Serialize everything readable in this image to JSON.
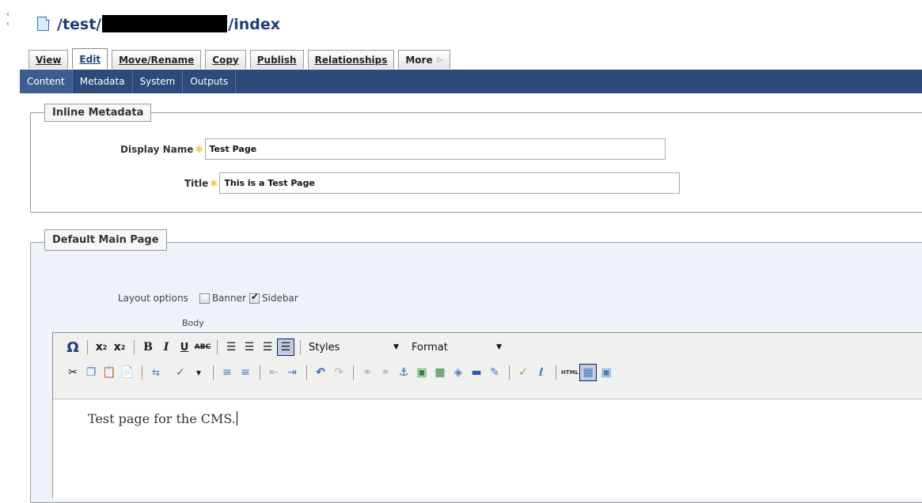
{
  "path": {
    "prefix": "/test/",
    "suffix": "/index"
  },
  "tabs": [
    {
      "label": "View"
    },
    {
      "label": "Edit"
    },
    {
      "label": "Move/Rename"
    },
    {
      "label": "Copy"
    },
    {
      "label": "Publish"
    },
    {
      "label": "Relationships"
    },
    {
      "label": "More"
    }
  ],
  "subnav": [
    {
      "label": "Content"
    },
    {
      "label": "Metadata"
    },
    {
      "label": "System"
    },
    {
      "label": "Outputs"
    }
  ],
  "inline_metadata": {
    "legend": "Inline Metadata",
    "display_name": {
      "label": "Display Name",
      "value": "Test Page"
    },
    "title": {
      "label": "Title",
      "value": "This is a Test Page"
    }
  },
  "default_main_page": {
    "legend": "Default Main Page",
    "layout_options_label": "Layout options",
    "banner_label": "Banner",
    "sidebar_label": "Sidebar",
    "banner_checked": false,
    "sidebar_checked": true,
    "body_label": "Body"
  },
  "editor": {
    "styles_label": "Styles",
    "format_label": "Format",
    "html_label": "HTML",
    "content": "Test page for the CMS."
  },
  "colors": {
    "subnav_bg": "#2c4a7a",
    "accent": "#1c3f7a",
    "fieldset_bg": "#eef3fa"
  }
}
